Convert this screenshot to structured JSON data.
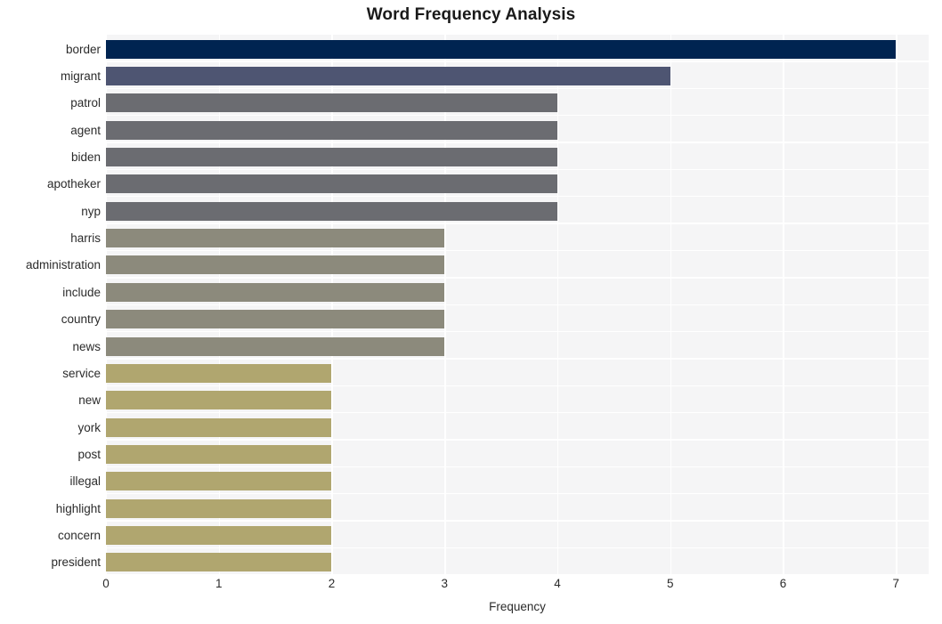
{
  "chart_data": {
    "type": "bar",
    "orientation": "horizontal",
    "title": "Word Frequency Analysis",
    "xlabel": "Frequency",
    "ylabel": "",
    "categories": [
      "border",
      "migrant",
      "patrol",
      "agent",
      "biden",
      "apotheker",
      "nyp",
      "harris",
      "administration",
      "include",
      "country",
      "news",
      "service",
      "new",
      "york",
      "post",
      "illegal",
      "highlight",
      "concern",
      "president"
    ],
    "values": [
      7,
      5,
      4,
      4,
      4,
      4,
      4,
      3,
      3,
      3,
      3,
      3,
      2,
      2,
      2,
      2,
      2,
      2,
      2,
      2
    ],
    "bar_colors": [
      "#002451",
      "#4e5572",
      "#6b6c71",
      "#6b6c71",
      "#6b6c71",
      "#6b6c71",
      "#6b6c71",
      "#8c8a7c",
      "#8c8a7c",
      "#8c8a7c",
      "#8c8a7c",
      "#8c8a7c",
      "#b0a66f",
      "#b0a66f",
      "#b0a66f",
      "#b0a66f",
      "#b0a66f",
      "#b0a66f",
      "#b0a66f",
      "#b0a66f"
    ],
    "xticks": [
      0,
      1,
      2,
      3,
      4,
      5,
      6,
      7
    ],
    "xtick_labels": [
      "0",
      "1",
      "2",
      "3",
      "4",
      "5",
      "6",
      "7"
    ],
    "xlim": [
      0,
      7.29
    ],
    "grid": true,
    "grid_color": "#ffffff",
    "plot_background": "#f5f5f6",
    "figure_background": "#ffffff",
    "legend": null
  }
}
